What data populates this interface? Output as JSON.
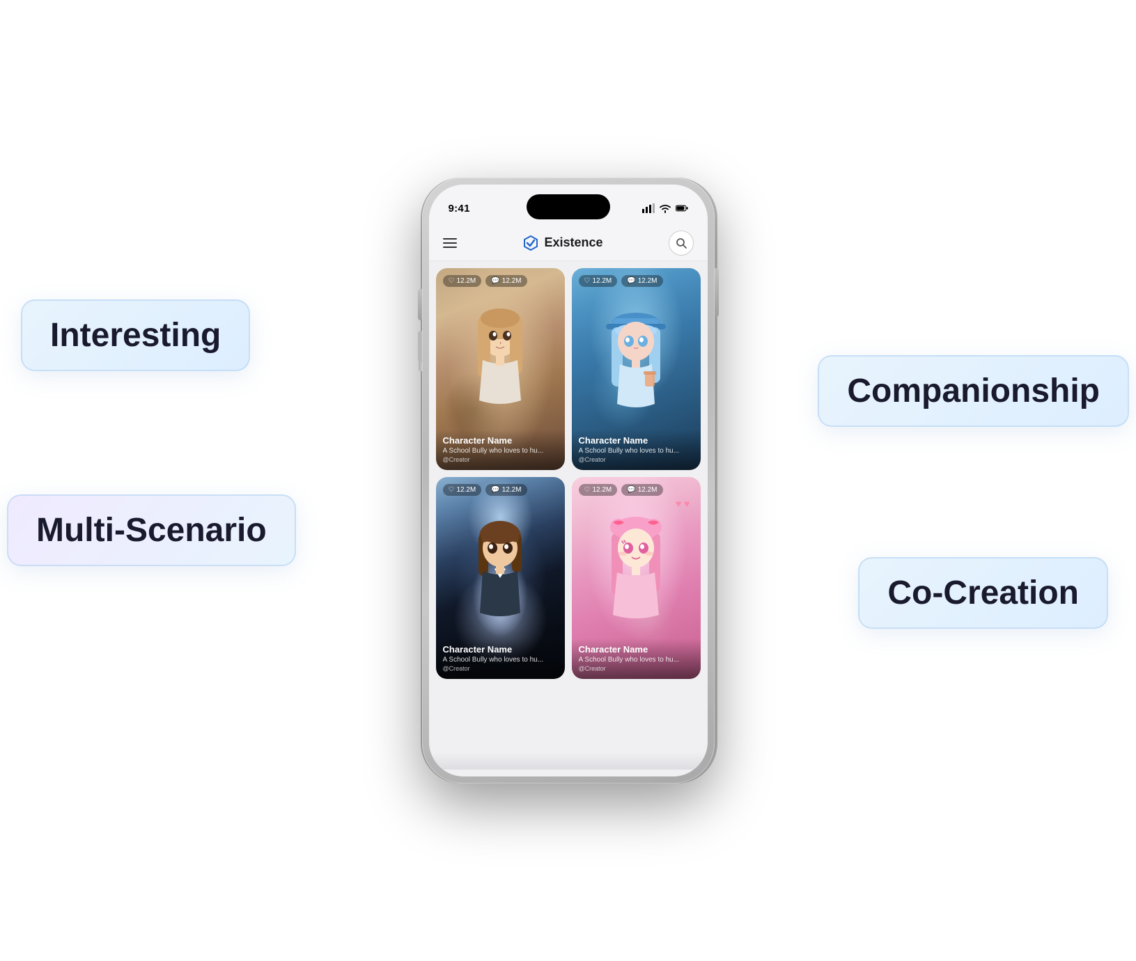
{
  "app": {
    "title": "Existence",
    "status_time": "9:41",
    "search_button_label": "Search"
  },
  "badges": {
    "interesting": "Interesting",
    "companionship": "Companionship",
    "multiscenario": "Multi-Scenario",
    "cocreation": "Co-Creation"
  },
  "cards": [
    {
      "id": 1,
      "name": "Character Name",
      "desc": "A School Bully who loves to hu...",
      "creator": "@Creator",
      "likes": "12.2M",
      "comments": "12.2M"
    },
    {
      "id": 2,
      "name": "Character Name",
      "desc": "A School Bully who loves to hu...",
      "creator": "@Creator",
      "likes": "12.2M",
      "comments": "12.2M"
    },
    {
      "id": 3,
      "name": "Character Name",
      "desc": "A School Bully who loves to hu...",
      "creator": "@Creator",
      "likes": "12.2M",
      "comments": "12.2M"
    },
    {
      "id": 4,
      "name": "Character Name",
      "desc": "A School Bully who loves to hu...",
      "creator": "@Creator",
      "likes": "12.2M",
      "comments": "12.2M"
    }
  ]
}
